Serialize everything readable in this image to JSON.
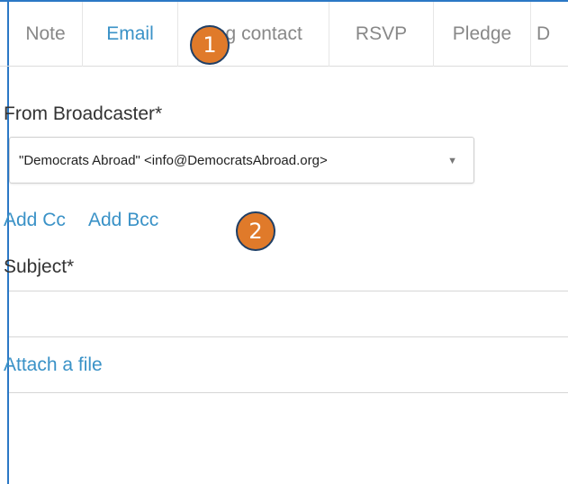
{
  "tabs": [
    {
      "label": "Note"
    },
    {
      "label": "Email",
      "active": true
    },
    {
      "label": "Log contact"
    },
    {
      "label": "RSVP"
    },
    {
      "label": "Pledge"
    },
    {
      "label": "D"
    }
  ],
  "form": {
    "from_label": "From Broadcaster*",
    "from_value": "\"Democrats Abroad\" <info@DemocratsAbroad.org>",
    "add_cc": "Add Cc",
    "add_bcc": "Add Bcc",
    "subject_label": "Subject*",
    "subject_value": "",
    "attach_label": "Attach a file"
  },
  "annotations": {
    "badge_1": "1",
    "badge_2": "2"
  },
  "colors": {
    "accent": "#3a92c7",
    "frame_border": "#2b78c5",
    "badge_fill": "#e07a2a",
    "badge_border": "#1f3f66"
  },
  "icons": {
    "select_caret": "caret-down-icon"
  }
}
